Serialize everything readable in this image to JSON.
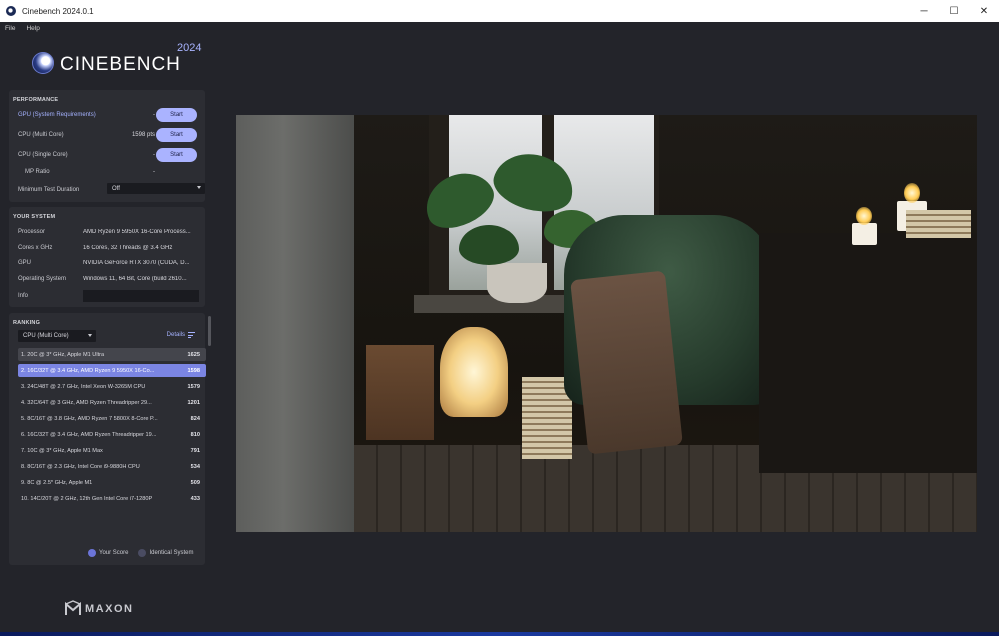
{
  "window": {
    "title": "Cinebench 2024.0.1",
    "controls": {
      "minimize": "─",
      "maximize": "☐",
      "close": "✕"
    }
  },
  "menu": [
    "File",
    "Help"
  ],
  "logo": {
    "name": "CINEBENCH",
    "year": "2024"
  },
  "performance": {
    "title": "PERFORMANCE",
    "rows": [
      {
        "label": "GPU (System Requirements)",
        "value": "-",
        "button": "Start"
      },
      {
        "label": "CPU (Multi Core)",
        "value": "1598 pts",
        "button": "Start"
      },
      {
        "label": "CPU (Single Core)",
        "value": "-",
        "button": "Start"
      }
    ],
    "mp_ratio": {
      "label": "MP Ratio",
      "value": "-"
    },
    "min_test_duration": {
      "label": "Minimum Test Duration",
      "value": "Off"
    }
  },
  "system": {
    "title": "YOUR SYSTEM",
    "rows": [
      {
        "label": "Processor",
        "value": "AMD Ryzen 9 5950X 16-Core Process..."
      },
      {
        "label": "Cores x GHz",
        "value": "16 Cores, 32 Threads @ 3.4 GHz"
      },
      {
        "label": "GPU",
        "value": "NVIDIA GeForce RTX 3070 (CUDA, D..."
      },
      {
        "label": "Operating System",
        "value": "Windows 11, 64 Bit, Core (build 2610..."
      }
    ],
    "info_label": "Info"
  },
  "ranking": {
    "title": "RANKING",
    "selected": "CPU (Multi Core)",
    "details": "Details",
    "items": [
      {
        "name": "1. 20C @ 3* GHz, Apple M1 Ultra",
        "score": "1625"
      },
      {
        "name": "2. 16C/32T @ 3.4 GHz, AMD Ryzen 9 5950X 16-Co...",
        "score": "1598"
      },
      {
        "name": "3. 24C/48T @ 2.7 GHz, Intel Xeon W-3265M CPU",
        "score": "1579"
      },
      {
        "name": "4. 32C/64T @ 3 GHz, AMD Ryzen Threadripper 29...",
        "score": "1201"
      },
      {
        "name": "5. 8C/16T @ 3.8 GHz, AMD Ryzen 7 5800X 8-Core P...",
        "score": "824"
      },
      {
        "name": "6. 16C/32T @ 3.4 GHz, AMD Ryzen Threadripper 19...",
        "score": "810"
      },
      {
        "name": "7. 10C @ 3* GHz, Apple M1 Max",
        "score": "791"
      },
      {
        "name": "8. 8C/16T @ 2.3 GHz, Intel Core i9-9880H CPU",
        "score": "534"
      },
      {
        "name": "9. 8C @ 2.5* GHz, Apple M1",
        "score": "509"
      },
      {
        "name": "10. 14C/20T @ 2 GHz, 12th Gen Intel Core i7-1280P",
        "score": "433"
      }
    ],
    "legend": {
      "your_score": "Your Score",
      "identical_system": "Identical System"
    }
  },
  "brand": {
    "maxon": "MAXON"
  },
  "colors": {
    "accent": "#aab3ff",
    "highlight": "#7b85e3",
    "panel": "#2c2d33",
    "background": "#23242a"
  }
}
